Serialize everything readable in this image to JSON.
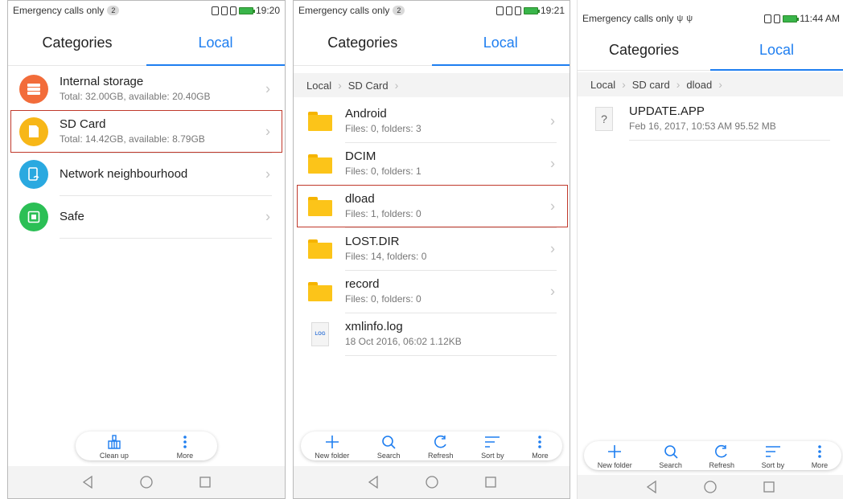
{
  "phone1": {
    "status": {
      "carrier": "Emergency calls only",
      "badge": "2",
      "time": "19:20"
    },
    "tabs": [
      {
        "label": "Categories"
      },
      {
        "label": "Local"
      }
    ],
    "rows": [
      {
        "title": "Internal storage",
        "sub": "Total: 32.00GB, available: 20.40GB"
      },
      {
        "title": "SD Card",
        "sub": "Total: 14.42GB, available: 8.79GB"
      },
      {
        "title": "Network neighbourhood"
      },
      {
        "title": "Safe"
      }
    ],
    "toolbar": [
      {
        "label": "Clean up"
      },
      {
        "label": "More"
      }
    ]
  },
  "phone2": {
    "status": {
      "carrier": "Emergency calls only",
      "badge": "2",
      "time": "19:21"
    },
    "tabs": [
      {
        "label": "Categories"
      },
      {
        "label": "Local"
      }
    ],
    "breadcrumb": [
      "Local",
      "SD Card"
    ],
    "rows": [
      {
        "title": "Android",
        "sub": "Files: 0, folders: 3"
      },
      {
        "title": "DCIM",
        "sub": "Files: 0, folders: 1"
      },
      {
        "title": "dload",
        "sub": "Files: 1, folders: 0"
      },
      {
        "title": "LOST.DIR",
        "sub": "Files: 14, folders: 0"
      },
      {
        "title": "record",
        "sub": "Files: 0, folders: 0"
      },
      {
        "title": "xmlinfo.log",
        "sub": "18 Oct 2016, 06:02 1.12KB",
        "icon_text": "LOG"
      }
    ],
    "toolbar": [
      {
        "label": "New folder"
      },
      {
        "label": "Search"
      },
      {
        "label": "Refresh"
      },
      {
        "label": "Sort by"
      },
      {
        "label": "More"
      }
    ]
  },
  "phone3": {
    "status": {
      "carrier": "Emergency calls only",
      "time": "11:44 AM"
    },
    "tabs": [
      {
        "label": "Categories"
      },
      {
        "label": "Local"
      }
    ],
    "breadcrumb": [
      "Local",
      "SD card",
      "dload"
    ],
    "rows": [
      {
        "title": "UPDATE.APP",
        "sub": "Feb 16, 2017, 10:53 AM 95.52 MB",
        "icon_text": "?"
      }
    ],
    "toolbar": [
      {
        "label": "New folder"
      },
      {
        "label": "Search"
      },
      {
        "label": "Refresh"
      },
      {
        "label": "Sort by"
      },
      {
        "label": "More"
      }
    ]
  },
  "colors": {
    "accent": "#1e7ef0",
    "highlight": "#c0392b",
    "folder": "#fcc419"
  }
}
